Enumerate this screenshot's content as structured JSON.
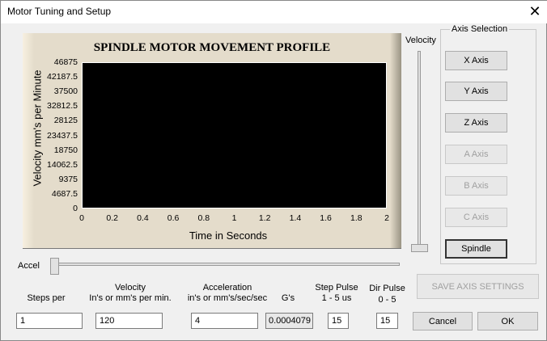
{
  "window": {
    "title": "Motor Tuning and Setup",
    "close": "✕"
  },
  "chart_data": {
    "type": "line",
    "title": "SPINDLE MOTOR MOVEMENT PROFILE",
    "xlabel": "Time in Seconds",
    "ylabel": "Velocity mm's per Minute",
    "xlim": [
      0,
      2
    ],
    "ylim": [
      0,
      46875
    ],
    "xticks": [
      "0",
      "0.2",
      "0.4",
      "0.6",
      "0.8",
      "1",
      "1.2",
      "1.4",
      "1.6",
      "1.8",
      "2"
    ],
    "yticks": [
      "46875",
      "42187.5",
      "37500",
      "32812.5",
      "28125",
      "23437.5",
      "18750",
      "14062.5",
      "9375",
      "4687.5",
      "0"
    ],
    "series": [],
    "background": "#000000"
  },
  "sliders": {
    "velocity_label": "Velocity",
    "accel_label": "Accel",
    "velocity_level": 0,
    "accel_level": 0
  },
  "axis_selection": {
    "label": "Axis Selection",
    "buttons": [
      {
        "label": "X Axis",
        "enabled": true
      },
      {
        "label": "Y Axis",
        "enabled": true
      },
      {
        "label": "Z Axis",
        "enabled": true
      },
      {
        "label": "A Axis",
        "enabled": false
      },
      {
        "label": "B Axis",
        "enabled": false
      },
      {
        "label": "C Axis",
        "enabled": false
      },
      {
        "label": "Spindle",
        "enabled": true,
        "selected": true
      }
    ]
  },
  "fields": {
    "steps_per": {
      "label": "Steps per",
      "value": "1"
    },
    "velocity": {
      "label1": "Velocity",
      "label2": "In's or mm's per min.",
      "value": "120"
    },
    "acceleration": {
      "label1": "Acceleration",
      "label2": "in's or mm's/sec/sec",
      "value": "4"
    },
    "gs": {
      "label": "G's",
      "value": "0.0004079"
    },
    "step_pulse": {
      "label1": "Step Pulse",
      "label2": "1 - 5 us",
      "value": "15"
    },
    "dir_pulse": {
      "label1": "Dir Pulse",
      "label2": "0 - 5",
      "value": "15"
    }
  },
  "buttons": {
    "save": "SAVE AXIS SETTINGS",
    "cancel": "Cancel",
    "ok": "OK"
  }
}
